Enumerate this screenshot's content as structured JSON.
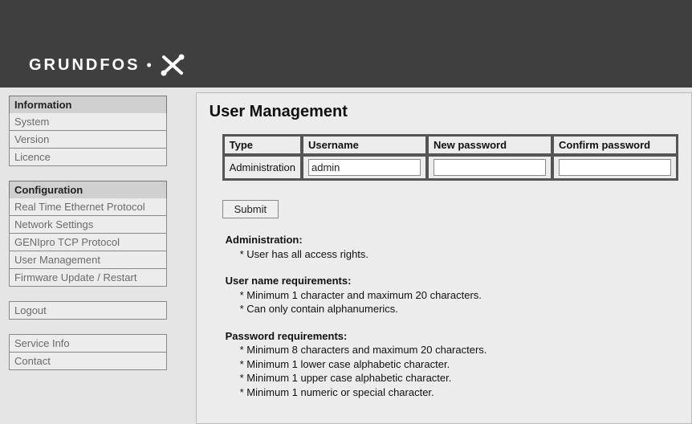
{
  "logo_text": "GRUNDFOS",
  "sidebar": {
    "groups": [
      {
        "header": "Information",
        "items": [
          "System",
          "Version",
          "Licence"
        ]
      },
      {
        "header": "Configuration",
        "items": [
          "Real Time Ethernet Protocol",
          "Network Settings",
          "GENIpro TCP Protocol",
          "User Management",
          "Firmware Update / Restart"
        ]
      }
    ],
    "logout": "Logout",
    "footer_items": [
      "Service Info",
      "Contact"
    ]
  },
  "main": {
    "title": "User Management",
    "table": {
      "headers": [
        "Type",
        "Username",
        "New password",
        "Confirm password"
      ],
      "row": {
        "type": "Administration",
        "username": "admin",
        "new_password": "",
        "confirm_password": ""
      }
    },
    "submit_label": "Submit",
    "notes": {
      "admin_title": "Administration:",
      "admin_b1": "* User has all access rights.",
      "user_title": "User name requirements:",
      "user_b1": "* Minimum 1 character and maximum 20 characters.",
      "user_b2": "* Can only contain alphanumerics.",
      "pw_title": "Password requirements:",
      "pw_b1": "* Minimum 8 characters and maximum 20 characters.",
      "pw_b2": "* Minimum 1 lower case alphabetic character.",
      "pw_b3": "* Minimum 1 upper case alphabetic character.",
      "pw_b4": "* Minimum 1 numeric or special character."
    }
  }
}
